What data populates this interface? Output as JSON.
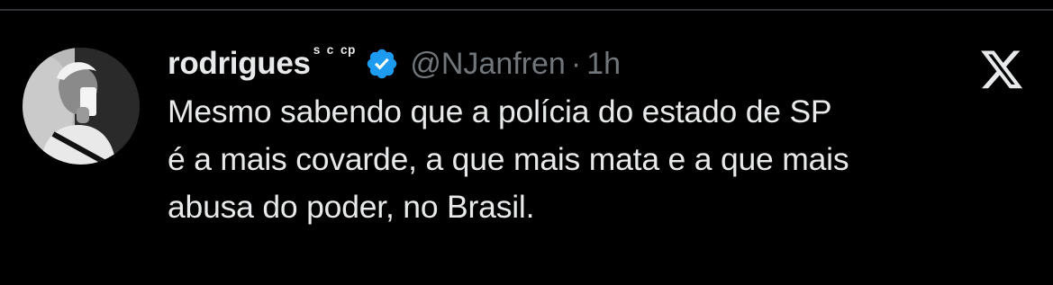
{
  "tweet": {
    "display_name": "rodrigues",
    "name_suffix": "ˢ ᶜ ᶜᵖ",
    "handle": "@NJanfren",
    "separator": "·",
    "time": "1h",
    "text": "Mesmo sabendo que a polícia do estado de SP\né a mais covarde, a que mais mata e a que mais\nabusa do poder, no Brasil.",
    "verified": true
  },
  "icons": {
    "avatar": "profile-photo",
    "badge": "verified-badge-icon",
    "logo": "x-logo-icon"
  },
  "colors": {
    "background": "#000000",
    "text": "#e7e9ea",
    "secondary_text": "#71767b",
    "verified_blue": "#1d9bf0"
  }
}
